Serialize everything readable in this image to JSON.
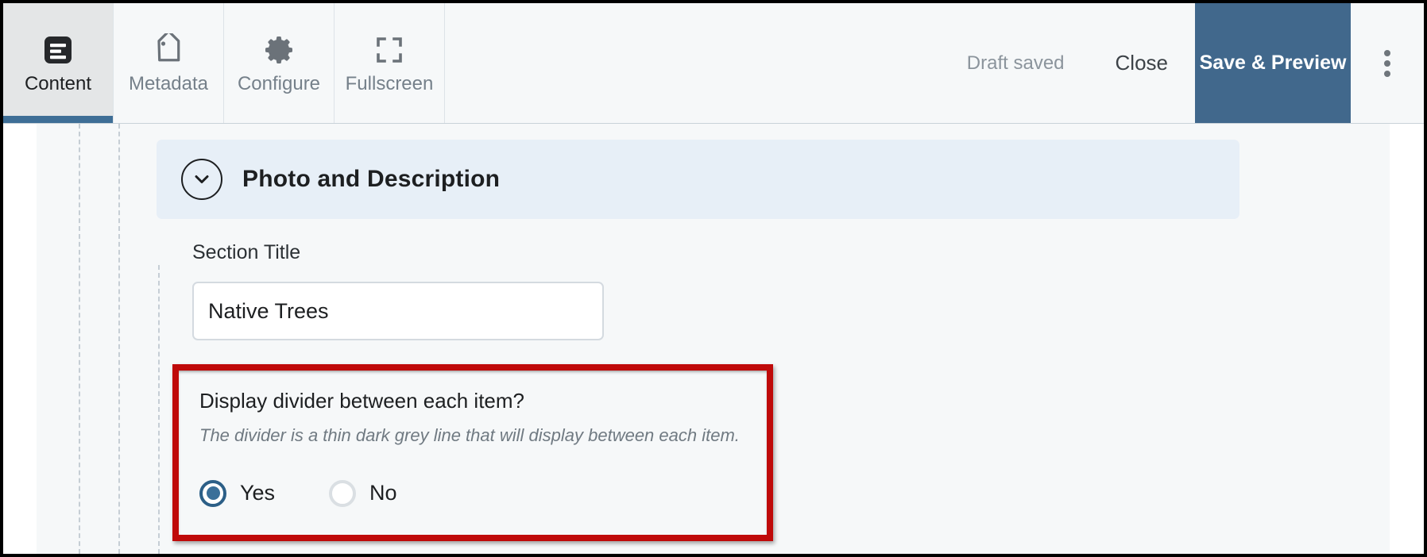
{
  "toolbar": {
    "tabs": [
      {
        "label": "Content",
        "icon": "document-lines-icon",
        "active": true
      },
      {
        "label": "Metadata",
        "icon": "tag-icon",
        "active": false
      },
      {
        "label": "Configure",
        "icon": "gear-icon",
        "active": false
      },
      {
        "label": "Fullscreen",
        "icon": "expand-icon",
        "active": false
      }
    ],
    "status_text": "Draft saved",
    "close_label": "Close",
    "save_preview_label": "Save & Preview",
    "overflow_icon": "kebab-menu-icon",
    "active_tab_accent": "#3e6e96",
    "primary_button_color": "#41688c"
  },
  "section": {
    "title": "Photo and Description",
    "collapse_icon": "chevron-down-icon",
    "header_background": "#e7eff7"
  },
  "form": {
    "section_title": {
      "label": "Section Title",
      "value": "Native Trees",
      "placeholder": "Section Title"
    },
    "divider_question": {
      "label": "Display divider between each item?",
      "helper": "The divider is a thin dark grey line that will display between each item.",
      "options": [
        {
          "label": "Yes",
          "selected": true
        },
        {
          "label": "No",
          "selected": false
        }
      ],
      "highlight_color": "#bf0a0a",
      "selected_radio_color": "#3a6f99"
    }
  }
}
